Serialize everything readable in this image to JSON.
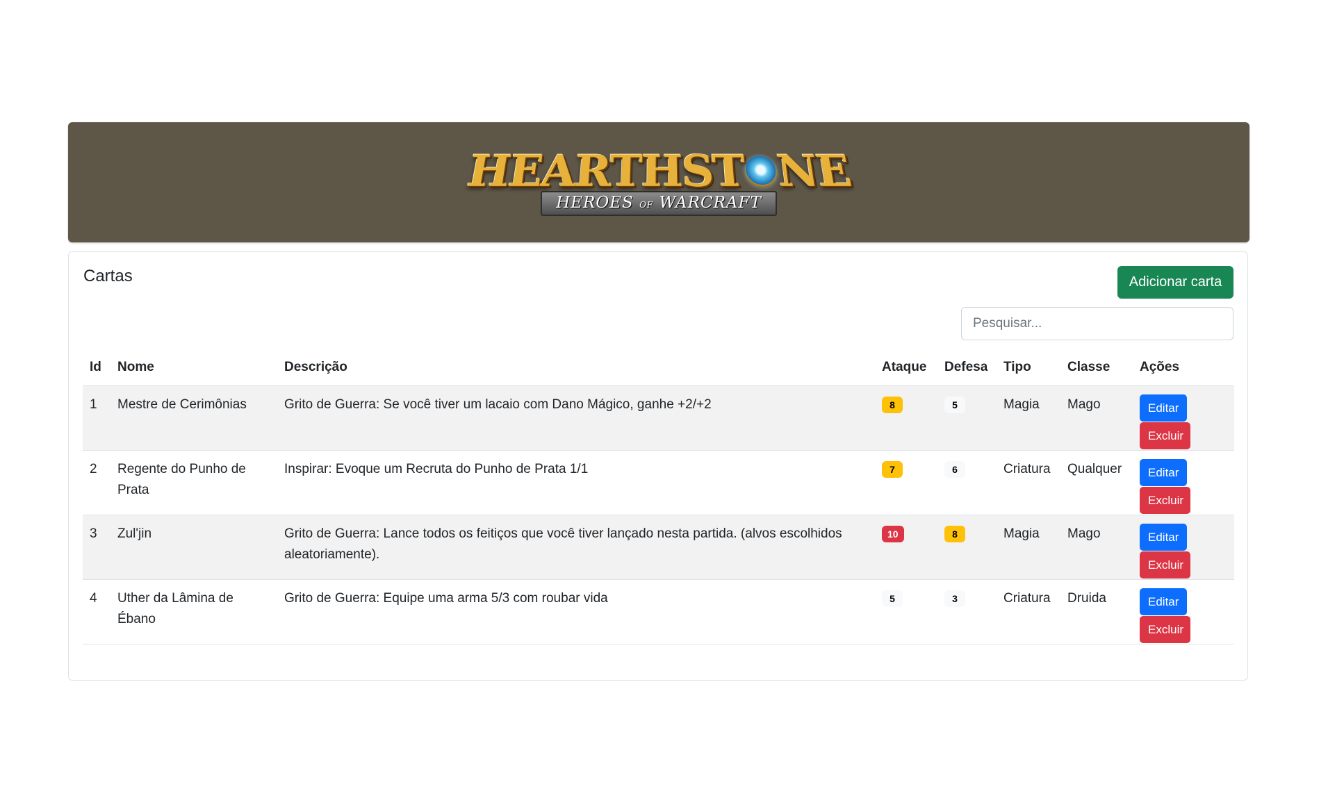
{
  "banner": {
    "logo_main_left": "HEARTHST",
    "logo_main_right": "NE",
    "logo_sub_left": "HEROES",
    "logo_sub_of": "OF",
    "logo_sub_right": "WARCRAFT"
  },
  "card": {
    "title": "Cartas",
    "add_button": "Adicionar carta",
    "search_placeholder": "Pesquisar..."
  },
  "table": {
    "headers": {
      "id": "Id",
      "nome": "Nome",
      "descricao": "Descrição",
      "ataque": "Ataque",
      "defesa": "Defesa",
      "tipo": "Tipo",
      "classe": "Classe",
      "acoes": "Ações"
    },
    "edit_label": "Editar",
    "delete_label": "Excluir",
    "rows": [
      {
        "id": "1",
        "nome": "Mestre de Cerimônias",
        "descricao": "Grito de Guerra: Se você tiver um lacaio com Dano Mágico, ganhe +2/+2",
        "ataque": "8",
        "defesa": "5",
        "tipo": "Magia",
        "classe": "Mago"
      },
      {
        "id": "2",
        "nome": "Regente do Punho de Prata",
        "descricao": "Inspirar: Evoque um Recruta do Punho de Prata 1/1",
        "ataque": "7",
        "defesa": "6",
        "tipo": "Criatura",
        "classe": "Qualquer"
      },
      {
        "id": "3",
        "nome": "Zul'jin",
        "descricao": "Grito de Guerra: Lance todos os feitiços que você tiver lançado nesta partida. (alvos escolhidos aleatoriamente).",
        "ataque": "10",
        "defesa": "8",
        "tipo": "Magia",
        "classe": "Mago"
      },
      {
        "id": "4",
        "nome": "Uther da Lâmina de Ébano",
        "descricao": "Grito de Guerra: Equipe uma arma 5/3 com roubar vida",
        "ataque": "5",
        "defesa": "3",
        "tipo": "Criatura",
        "classe": "Druida"
      }
    ]
  }
}
